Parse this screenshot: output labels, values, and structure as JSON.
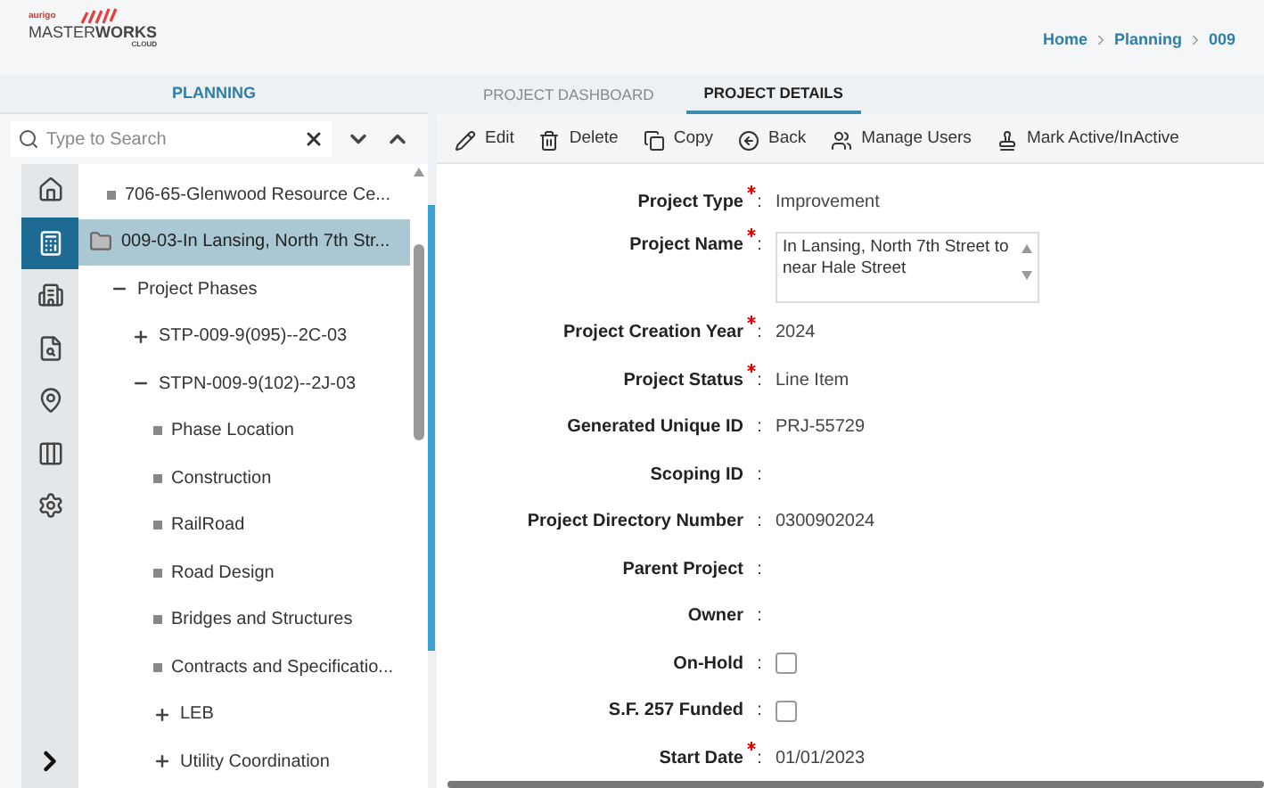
{
  "logo": {
    "brand": "aurigo",
    "name": "MASTER**WORKS**",
    "sub": "CLOUD"
  },
  "breadcrumb": [
    "Home",
    "Planning",
    "009"
  ],
  "left_tabs": [
    {
      "label": "PLANNING",
      "selected": true
    }
  ],
  "search": {
    "placeholder": "Type to Search"
  },
  "rail": [
    {
      "kind": "home",
      "selected": false
    },
    {
      "kind": "estimate",
      "selected": true
    },
    {
      "kind": "building",
      "selected": false
    },
    {
      "kind": "document",
      "selected": false
    },
    {
      "kind": "map",
      "selected": false
    },
    {
      "kind": "columns",
      "selected": false
    },
    {
      "kind": "settings",
      "selected": false
    }
  ],
  "tree": [
    {
      "kind": "leaf",
      "label": "706-65-Glenwood Resource Ce...",
      "selected": false
    },
    {
      "kind": "folder",
      "label": "009-03-In Lansing, North 7th Str...",
      "selected": true,
      "children": [
        {
          "kind": "node",
          "label": "Project Phases",
          "expanded": true,
          "selected": false,
          "children": [
            {
              "kind": "node",
              "label": "STP-009-9(095)--2C-03",
              "expanded": false,
              "selected": false
            },
            {
              "kind": "node",
              "label": "STPN-009-9(102)--2J-03",
              "expanded": true,
              "selected": false,
              "children": [
                {
                  "kind": "leaf",
                  "label": "Phase Location",
                  "selected": false
                },
                {
                  "kind": "leaf",
                  "label": "Construction",
                  "selected": false
                },
                {
                  "kind": "leaf",
                  "label": "RailRoad",
                  "selected": false
                },
                {
                  "kind": "leaf",
                  "label": "Road Design",
                  "selected": false
                },
                {
                  "kind": "leaf",
                  "label": "Bridges and Structures",
                  "selected": false
                },
                {
                  "kind": "leaf",
                  "label": "Contracts and Specificatio...",
                  "selected": false
                },
                {
                  "kind": "node",
                  "label": "LEB",
                  "expanded": false,
                  "selected": false
                },
                {
                  "kind": "node",
                  "label": "Utility Coordination",
                  "expanded": false,
                  "selected": false
                }
              ]
            }
          ]
        }
      ]
    }
  ],
  "tabs": [
    {
      "label": "PROJECT DASHBOARD",
      "selected": false
    },
    {
      "label": "PROJECT DETAILS",
      "selected": true
    }
  ],
  "toolbar": [
    {
      "kind": "edit",
      "label": "Edit"
    },
    {
      "kind": "delete",
      "label": "Delete"
    },
    {
      "kind": "copy",
      "label": "Copy"
    },
    {
      "kind": "back",
      "label": "Back"
    },
    {
      "kind": "users",
      "label": "Manage Users"
    },
    {
      "kind": "mark",
      "label": "Mark Active/InActive"
    }
  ],
  "form": [
    {
      "kind": "text",
      "label": "Project Type",
      "required": true,
      "separator": ":",
      "value": "Improvement"
    },
    {
      "kind": "textarea",
      "label": "Project Name",
      "required": true,
      "separator": ":",
      "value": "In Lansing, North 7th Street to near Hale Street"
    },
    {
      "kind": "text",
      "label": "Project Creation Year",
      "required": true,
      "separator": ":",
      "value": "2024"
    },
    {
      "kind": "text",
      "label": "Project Status",
      "required": true,
      "separator": ":",
      "value": "Line Item"
    },
    {
      "kind": "text",
      "label": "Generated Unique ID",
      "required": false,
      "separator": ":",
      "value": "PRJ-55729"
    },
    {
      "kind": "text",
      "label": "Scoping ID",
      "required": false,
      "separator": ":"
    },
    {
      "kind": "text",
      "label": "Project Directory Number",
      "required": false,
      "separator": ":",
      "value": "0300902024"
    },
    {
      "kind": "text",
      "label": "Parent Project",
      "required": false,
      "separator": ":"
    },
    {
      "kind": "text",
      "label": "Owner",
      "required": false,
      "separator": ":"
    },
    {
      "kind": "checkbox",
      "label": "On-Hold",
      "required": false,
      "separator": ":",
      "checked": false
    },
    {
      "kind": "checkbox",
      "label": "S.F. 257 Funded",
      "required": false,
      "separator": ":",
      "checked": false
    },
    {
      "kind": "text",
      "label": "Start Date",
      "required": true,
      "separator": ":",
      "value": "01/01/2023"
    }
  ]
}
